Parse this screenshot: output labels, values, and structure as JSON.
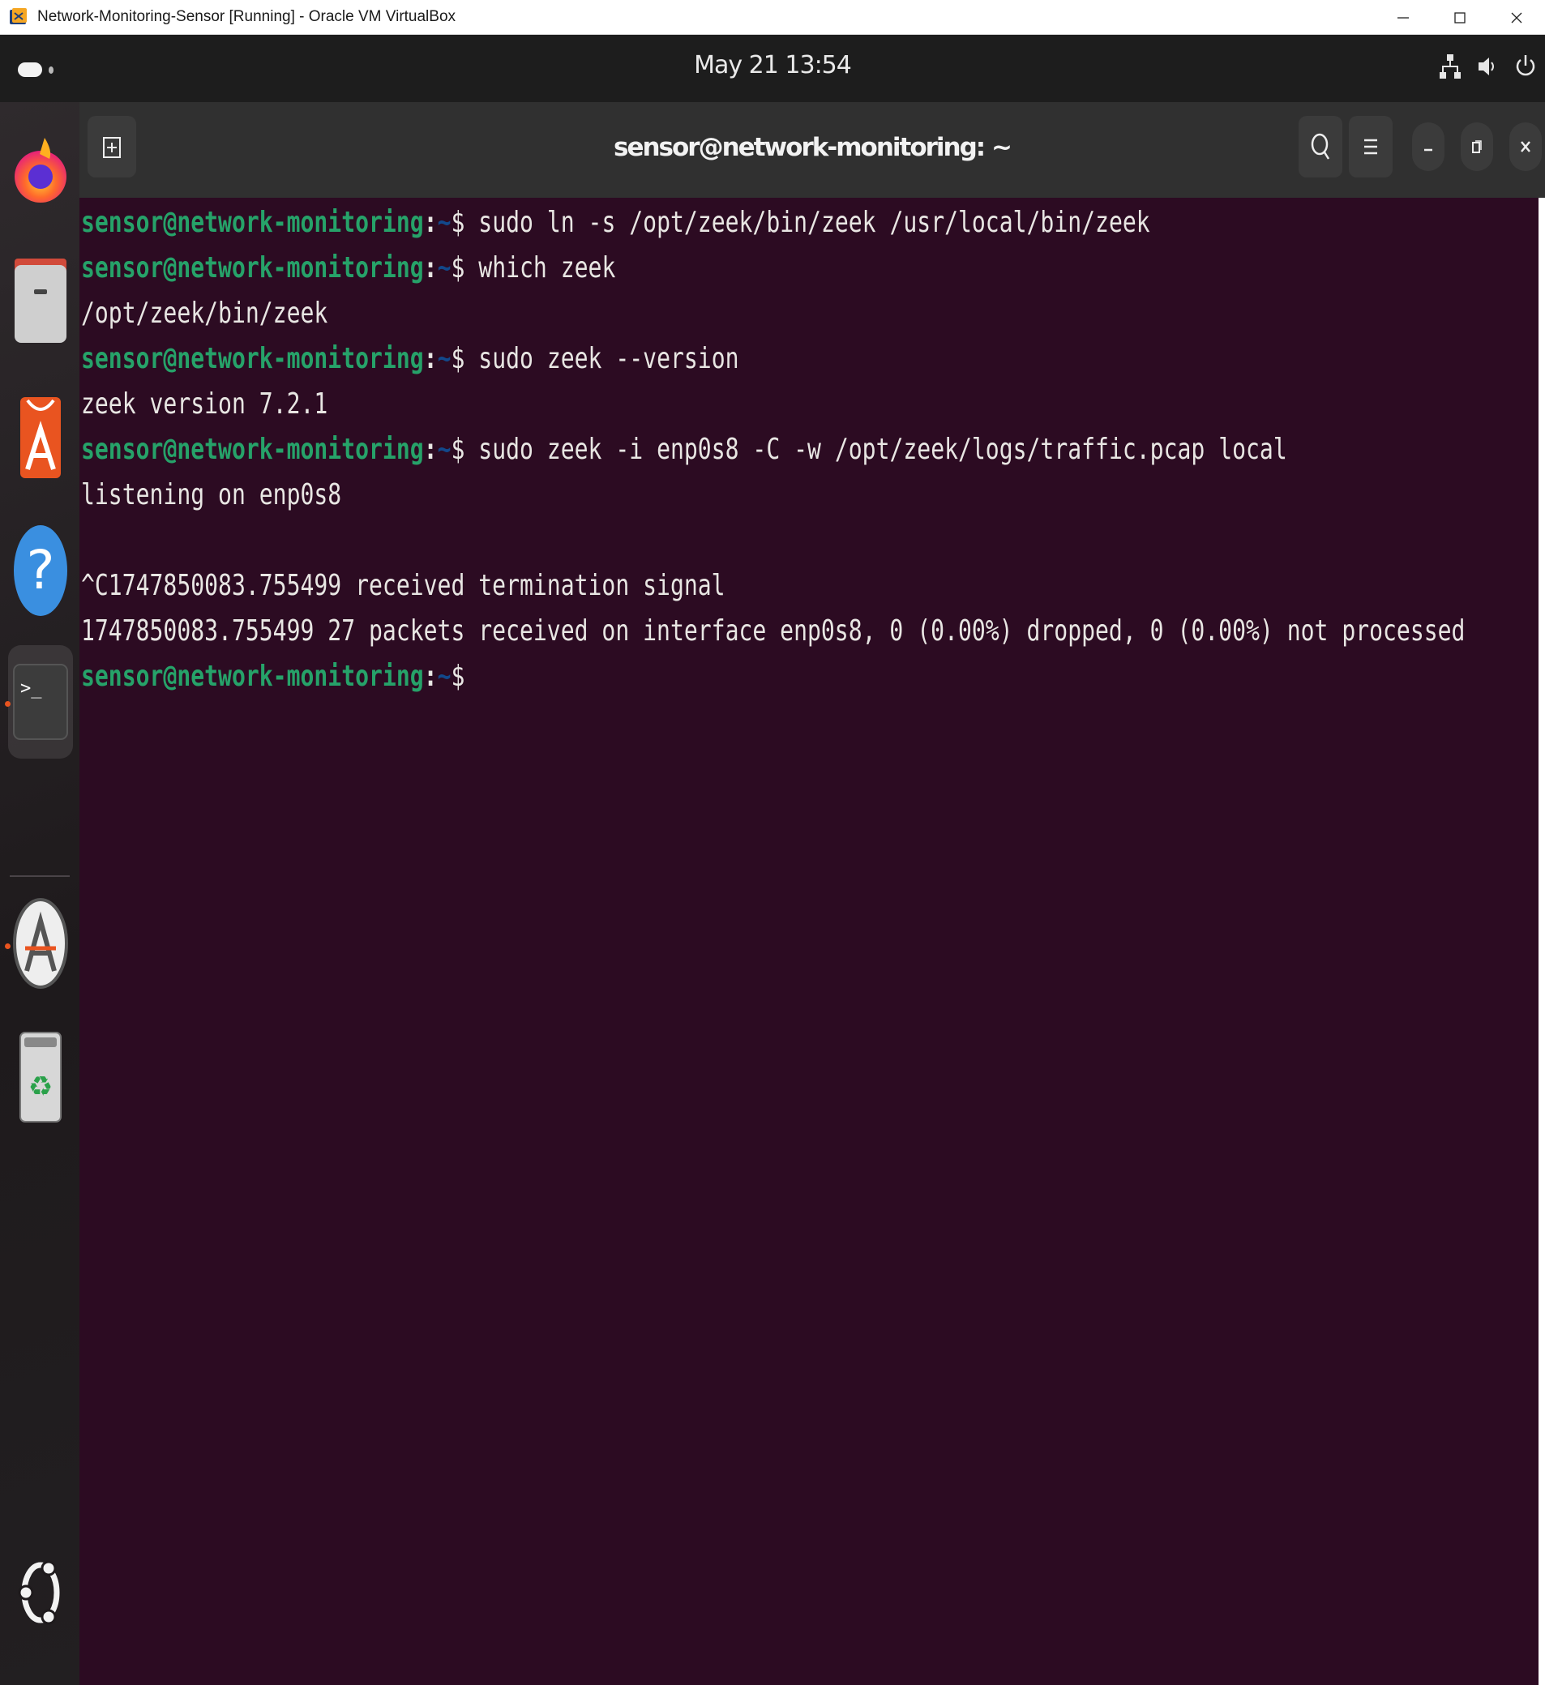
{
  "host_window": {
    "title": "Network-Monitoring-Sensor [Running] - Oracle VM VirtualBox",
    "controls": [
      "minimize-icon",
      "maximize-icon",
      "close-icon"
    ]
  },
  "topbar": {
    "clock": "May 21  13:54",
    "tray_icons": [
      "network-icon",
      "volume-icon",
      "power-icon"
    ]
  },
  "dock": {
    "items": [
      {
        "name": "firefox",
        "icon": "firefox-icon"
      },
      {
        "name": "files",
        "icon": "files-icon"
      },
      {
        "name": "app-center",
        "icon": "app-center-icon"
      },
      {
        "name": "help",
        "icon": "help-icon"
      },
      {
        "name": "terminal",
        "icon": "terminal-icon",
        "active": true
      },
      {
        "name": "software-updater",
        "icon": "software-updater-icon"
      },
      {
        "name": "trash",
        "icon": "trash-icon"
      },
      {
        "name": "show-apps",
        "icon": "ubuntu-logo-icon"
      }
    ]
  },
  "terminal": {
    "title": "sensor@network-monitoring: ~",
    "header_buttons": [
      "new-tab-icon",
      "search-icon",
      "menu-icon",
      "minimize-icon",
      "restore-icon",
      "close-icon"
    ],
    "prompt_user": "sensor@network-monitoring",
    "prompt_colon": ":",
    "prompt_path": "~",
    "prompt_symbol": "$",
    "lines": [
      {
        "type": "cmd",
        "text": " sudo ln -s /opt/zeek/bin/zeek /usr/local/bin/zeek"
      },
      {
        "type": "cmd",
        "text": " which zeek"
      },
      {
        "type": "out",
        "text": "/opt/zeek/bin/zeek"
      },
      {
        "type": "cmd",
        "text": " sudo zeek --version"
      },
      {
        "type": "out",
        "text": "zeek version 7.2.1"
      },
      {
        "type": "cmd",
        "text": " sudo zeek -i enp0s8 -C -w /opt/zeek/logs/traffic.pcap local"
      },
      {
        "type": "out",
        "text": "listening on enp0s8"
      },
      {
        "type": "out",
        "text": ""
      },
      {
        "type": "out",
        "text": "^C1747850083.755499 received termination signal"
      },
      {
        "type": "out",
        "text": "1747850083.755499 27 packets received on interface enp0s8, 0 (0.00%) dropped, 0 (0.00%) not processed"
      },
      {
        "type": "cmd",
        "text": ""
      }
    ]
  },
  "colors": {
    "terminal_bg": "#2c0b22",
    "prompt_user": "#26a269",
    "prompt_path": "#12488b",
    "text": "#e8e6e3"
  }
}
